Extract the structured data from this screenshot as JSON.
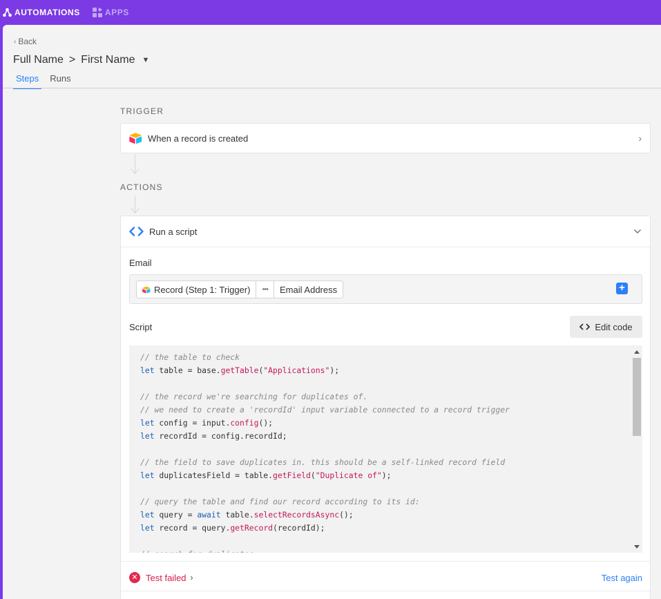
{
  "topbar": {
    "automations_label": "AUTOMATIONS",
    "apps_label": "APPS",
    "bg_color": "#7b3ae4"
  },
  "header": {
    "back_label": "Back",
    "title_left": "Full Name",
    "title_sep": ">",
    "title_right": "First Name",
    "tabs": [
      {
        "label": "Steps",
        "active": true
      },
      {
        "label": "Runs",
        "active": false
      }
    ]
  },
  "trigger": {
    "section_label": "TRIGGER",
    "card_label": "When a record is created"
  },
  "actions": {
    "section_label": "ACTIONS",
    "card_label": "Run a script",
    "email_label": "Email",
    "email_token": {
      "record": "Record (Step 1: Trigger)",
      "dots": "•••",
      "field": "Email Address"
    },
    "script_label": "Script",
    "edit_code_label": "Edit code",
    "status_text": "Test failed",
    "test_again_label": "Test again"
  },
  "code": {
    "lines": [
      [
        {
          "t": "// the table to check",
          "c": "comment"
        }
      ],
      [
        {
          "t": "let",
          "c": "kw"
        },
        {
          "t": " table = base."
        },
        {
          "t": "getTable",
          "c": "fn"
        },
        {
          "t": "("
        },
        {
          "t": "\"Applications\"",
          "c": "str"
        },
        {
          "t": ");"
        }
      ],
      [],
      [
        {
          "t": "// the record we're searching for duplicates of.",
          "c": "comment"
        }
      ],
      [
        {
          "t": "// we need to create a 'recordId' input variable connected to a record trigger",
          "c": "comment"
        }
      ],
      [
        {
          "t": "let",
          "c": "kw"
        },
        {
          "t": " config = input."
        },
        {
          "t": "config",
          "c": "fn"
        },
        {
          "t": "();"
        }
      ],
      [
        {
          "t": "let",
          "c": "kw"
        },
        {
          "t": " recordId = config.recordId;"
        }
      ],
      [],
      [
        {
          "t": "// the field to save duplicates in. this should be a self-linked record field",
          "c": "comment"
        }
      ],
      [
        {
          "t": "let",
          "c": "kw"
        },
        {
          "t": " duplicatesField = table."
        },
        {
          "t": "getField",
          "c": "fn"
        },
        {
          "t": "("
        },
        {
          "t": "\"Duplicate of\"",
          "c": "str"
        },
        {
          "t": ");"
        }
      ],
      [],
      [
        {
          "t": "// query the table and find our record according to its id:",
          "c": "comment"
        }
      ],
      [
        {
          "t": "let",
          "c": "kw"
        },
        {
          "t": " query = "
        },
        {
          "t": "await",
          "c": "kw"
        },
        {
          "t": " table."
        },
        {
          "t": "selectRecordsAsync",
          "c": "fn"
        },
        {
          "t": "();"
        }
      ],
      [
        {
          "t": "let",
          "c": "kw"
        },
        {
          "t": " record = query."
        },
        {
          "t": "getRecord",
          "c": "fn"
        },
        {
          "t": "(recordId);"
        }
      ],
      [],
      [
        {
          "t": "// search for duplicates",
          "c": "comment"
        }
      ]
    ]
  }
}
